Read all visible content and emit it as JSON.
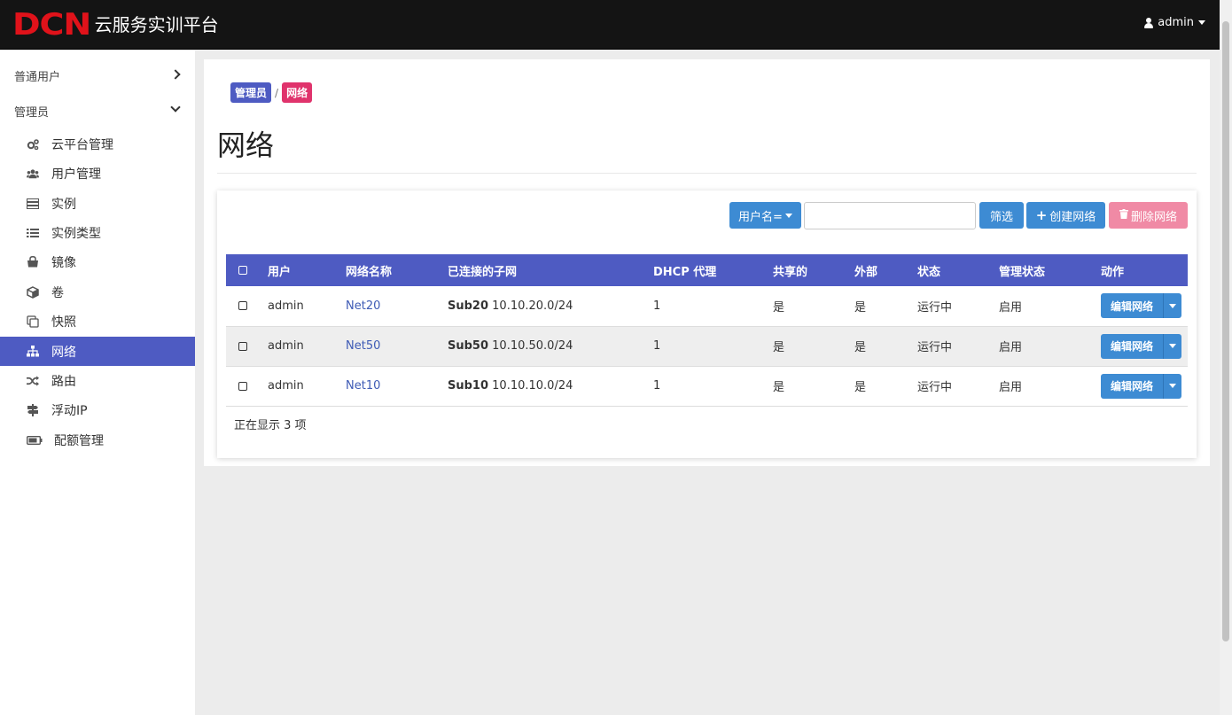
{
  "header": {
    "logo_mark": "DCN",
    "logo_text": "云服务实训平台",
    "user": "admin"
  },
  "sidebar": {
    "groups": [
      {
        "label": "普通用户",
        "expanded": false
      },
      {
        "label": "管理员",
        "expanded": true
      }
    ],
    "items": [
      {
        "label": "云平台管理",
        "icon": "cogs-icon"
      },
      {
        "label": "用户管理",
        "icon": "users-icon"
      },
      {
        "label": "实例",
        "icon": "server-icon"
      },
      {
        "label": "实例类型",
        "icon": "list-icon"
      },
      {
        "label": "镜像",
        "icon": "bag-icon"
      },
      {
        "label": "卷",
        "icon": "cube-icon"
      },
      {
        "label": "快照",
        "icon": "clone-icon"
      },
      {
        "label": "网络",
        "icon": "sitemap-icon",
        "active": true
      },
      {
        "label": "路由",
        "icon": "random-icon"
      },
      {
        "label": "浮动IP",
        "icon": "signs-icon"
      },
      {
        "label": "配额管理",
        "icon": "battery-icon"
      }
    ]
  },
  "breadcrumb": {
    "admin": "管理员",
    "sep": "/",
    "current": "网络"
  },
  "page": {
    "title": "网络"
  },
  "toolbar": {
    "filter_field": "用户名=",
    "filter_value": "",
    "filter_button": "筛选",
    "create_button": "创建网络",
    "delete_button": "删除网络"
  },
  "table": {
    "headers": [
      "用户",
      "网络名称",
      "已连接的子网",
      "DHCP 代理",
      "共享的",
      "外部",
      "状态",
      "管理状态",
      "动作"
    ],
    "rows": [
      {
        "user": "admin",
        "name": "Net20",
        "subnet_name": "Sub20",
        "subnet_cidr": "10.10.20.0/24",
        "dhcp": "1",
        "shared": "是",
        "external": "是",
        "status": "运行中",
        "admin_state": "启用",
        "action": "编辑网络"
      },
      {
        "user": "admin",
        "name": "Net50",
        "subnet_name": "Sub50",
        "subnet_cidr": "10.10.50.0/24",
        "dhcp": "1",
        "shared": "是",
        "external": "是",
        "status": "运行中",
        "admin_state": "启用",
        "action": "编辑网络"
      },
      {
        "user": "admin",
        "name": "Net10",
        "subnet_name": "Sub10",
        "subnet_cidr": "10.10.10.0/24",
        "dhcp": "1",
        "shared": "是",
        "external": "是",
        "status": "运行中",
        "admin_state": "启用",
        "action": "编辑网络"
      }
    ]
  },
  "footer": {
    "count_text": "正在显示 3 项"
  }
}
